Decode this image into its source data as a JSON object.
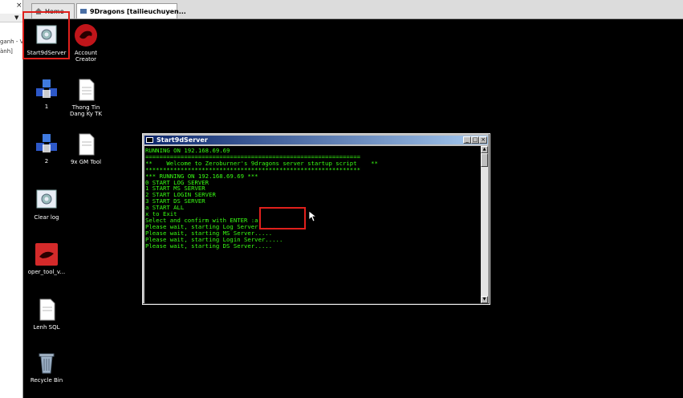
{
  "browser": {
    "tabs": [
      {
        "label": "Home"
      },
      {
        "label": "9Dragons  [tailieuchuyen...",
        "close": "×"
      }
    ]
  },
  "left_window": {
    "close": "×",
    "dropdown": "▼",
    "text_lines": [
      "ganh - V",
      "ành]"
    ]
  },
  "desktop": {
    "icons": [
      {
        "label": "Start9dServer"
      },
      {
        "label": "Account\nCreator"
      },
      {
        "label": "1"
      },
      {
        "label": "Thong Tin\nDang Ky TK"
      },
      {
        "label": "2"
      },
      {
        "label": "9x GM Tool"
      },
      {
        "label": "Clear log"
      },
      {
        "label": "oper_tool_v..."
      },
      {
        "label": "Lenh SQL"
      },
      {
        "label": "Recycle Bin"
      }
    ]
  },
  "console": {
    "title": "Start9dServer",
    "buttons": {
      "minimize": "_",
      "maximize": "□",
      "close": "×"
    },
    "text_color": "#39ff14",
    "lines": [
      "RUNNING ON 192.168.69.69",
      "=============================================================",
      "**    Welcome to Zeroburner's 9dragons server startup script    **",
      "*************************************************************",
      "*** RUNNING ON 192.168.69.69 ***",
      "0 START LOG SERVER",
      "1 START MS SERVER",
      "2 START LOGIN SERVER",
      "3 START DS SERVER",
      "a START ALL",
      "x to Exit",
      "Select and confirm with ENTER :a",
      "Please wait, starting Log Server.....",
      "Please wait, starting MS Server.....",
      "Please wait, starting Login Server.....",
      "Please wait, starting DS Server....."
    ]
  },
  "colors": {
    "highlight_box": "#e0201c",
    "desktop_bg": "#000000"
  }
}
